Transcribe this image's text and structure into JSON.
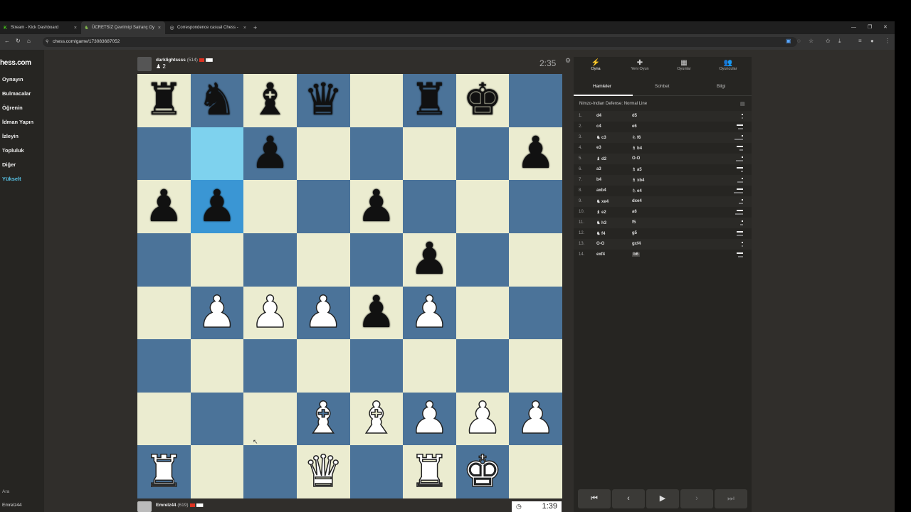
{
  "browser": {
    "tabs": [
      {
        "label": "Stream - Kick Dashboard",
        "fav": "K"
      },
      {
        "label": "ÜCRETSİZ Çevrimiçi Satranç Oy",
        "fav": "♞"
      },
      {
        "label": "Correspondence casual Chess -",
        "fav": "◎"
      }
    ],
    "url": "chess.com/game/173083687052"
  },
  "sidebar": {
    "logo": "hess.com",
    "items": [
      "Oynayın",
      "Bulmacalar",
      "Öğrenin",
      "İdman Yapın",
      "İzleyin",
      "Topluluk",
      "Diğer"
    ],
    "upgrade": "Yükselt",
    "search": "Ara",
    "user": "Emrelz44"
  },
  "top_player": {
    "name": "darklightssss",
    "rating": "(514)",
    "captured": "♟ 2",
    "clock": "2:35"
  },
  "bottom_player": {
    "name": "Emrelz44",
    "rating": "(619)",
    "clock": "1:39"
  },
  "board": [
    [
      "br",
      "bn",
      "bb",
      "bq",
      "",
      "br",
      "bk",
      ""
    ],
    [
      "",
      "",
      "bp",
      "",
      "",
      "",
      "",
      "bp"
    ],
    [
      "bp",
      "bp",
      "",
      "",
      "bp",
      "",
      "",
      ""
    ],
    [
      "",
      "",
      "",
      "",
      "",
      "bp",
      "",
      ""
    ],
    [
      "",
      "wp",
      "wp",
      "wp",
      "bp",
      "wp",
      "",
      ""
    ],
    [
      "",
      "",
      "",
      "",
      "",
      "",
      "",
      ""
    ],
    [
      "",
      "",
      "",
      "wb",
      "wb",
      "wp",
      "wp",
      "wp"
    ],
    [
      "wr",
      "",
      "",
      "wq",
      "",
      "wr",
      "wk",
      ""
    ]
  ],
  "panel": {
    "tabs": [
      {
        "label": "Oyna",
        "icon": "⚡"
      },
      {
        "label": "Yeni Oyun",
        "icon": "✚"
      },
      {
        "label": "Oyunlar",
        "icon": "▦"
      },
      {
        "label": "Oyuncular",
        "icon": "👥"
      }
    ],
    "subtabs": [
      "Hamleler",
      "Sohbet",
      "Bilgi"
    ],
    "opening": "Nimzo-Indian Defense: Normal Line",
    "moves": [
      {
        "n": "1.",
        "w": "d4",
        "b": "d5"
      },
      {
        "n": "2.",
        "w": "c4",
        "b": "e6"
      },
      {
        "n": "3.",
        "w": "♞ c3",
        "b": "♘ f6"
      },
      {
        "n": "4.",
        "w": "e3",
        "b": "♗ b4"
      },
      {
        "n": "5.",
        "w": "♝ d2",
        "b": "O-O"
      },
      {
        "n": "6.",
        "w": "a3",
        "b": "♗ a5"
      },
      {
        "n": "7.",
        "w": "b4",
        "b": "♗ xb4"
      },
      {
        "n": "8.",
        "w": "axb4",
        "b": "♘ e4"
      },
      {
        "n": "9.",
        "w": "♞ xe4",
        "b": "dxe4"
      },
      {
        "n": "10.",
        "w": "♝ e2",
        "b": "a6"
      },
      {
        "n": "11.",
        "w": "♞ h3",
        "b": "f5"
      },
      {
        "n": "12.",
        "w": "♞ f4",
        "b": "g5"
      },
      {
        "n": "13.",
        "w": "O-O",
        "b": "gxf4"
      },
      {
        "n": "14.",
        "w": "exf4",
        "b": "b6"
      }
    ],
    "controls": [
      "⏮",
      "‹",
      "▶",
      "›",
      "⏭"
    ]
  },
  "colors": {
    "light": "#ebecd0",
    "dark": "#4b7399",
    "highlight_from": "#7ed2ee",
    "highlight_to": "#3a96d4"
  }
}
